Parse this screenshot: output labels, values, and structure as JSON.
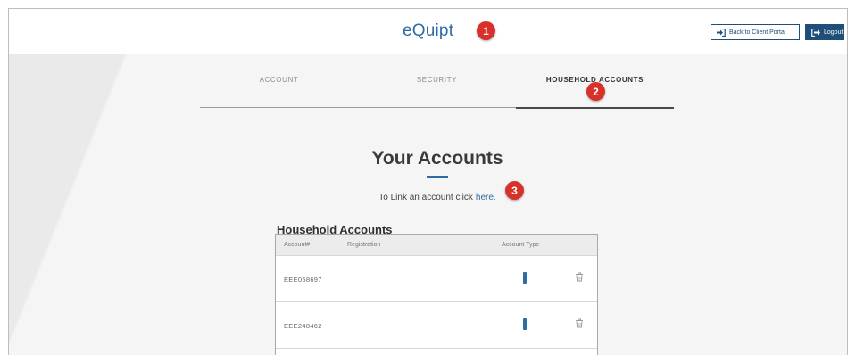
{
  "header": {
    "logo": "eQuipt",
    "back_label": "Back to Client Portal",
    "logout_label": "Logout"
  },
  "callouts": [
    "1",
    "2",
    "3"
  ],
  "tabs": [
    {
      "label": "ACCOUNT",
      "active": false
    },
    {
      "label": "SECURITY",
      "active": false
    },
    {
      "label": "HOUSEHOLD ACCOUNTS",
      "active": true
    }
  ],
  "main": {
    "title": "Your Accounts",
    "link_prefix": "To Link an account click",
    "link_text": "here."
  },
  "household": {
    "section_title": "Household Accounts",
    "columns": [
      "Account#",
      "Registration",
      "Account Type"
    ],
    "rows": [
      {
        "account": "EEE058697",
        "registration": ""
      },
      {
        "account": "EEE248462",
        "registration": ""
      }
    ]
  },
  "icons": {
    "back": "sign-in-icon",
    "logout": "sign-out-icon",
    "account_type": "account-type-bar-icon",
    "delete": "trash-icon"
  },
  "colors": {
    "brand": "#2e6ca4",
    "dark_button": "#1f4e79",
    "callout": "#d7312a",
    "page_bg": "#f4f4f4"
  }
}
